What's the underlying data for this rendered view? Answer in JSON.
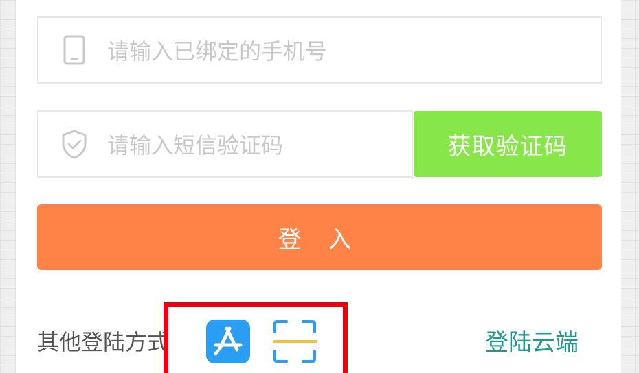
{
  "form": {
    "phone_placeholder": "请输入已绑定的手机号",
    "sms_placeholder": "请输入短信验证码",
    "get_code_label": "获取验证码",
    "login_label": "登 入"
  },
  "footer": {
    "other_methods_label": "其他登陆方式",
    "cloud_login_label": "登陆云端"
  },
  "icons": {
    "phone": "phone-icon",
    "shield": "shield-icon",
    "appstore": "appstore-icon",
    "scan": "scan-icon"
  },
  "colors": {
    "get_code_bg": "#86e64a",
    "login_bg": "#ff8247",
    "link": "#1e9b8c",
    "appstore_bg": "#2a9ef3",
    "highlight": "#f0000f"
  }
}
